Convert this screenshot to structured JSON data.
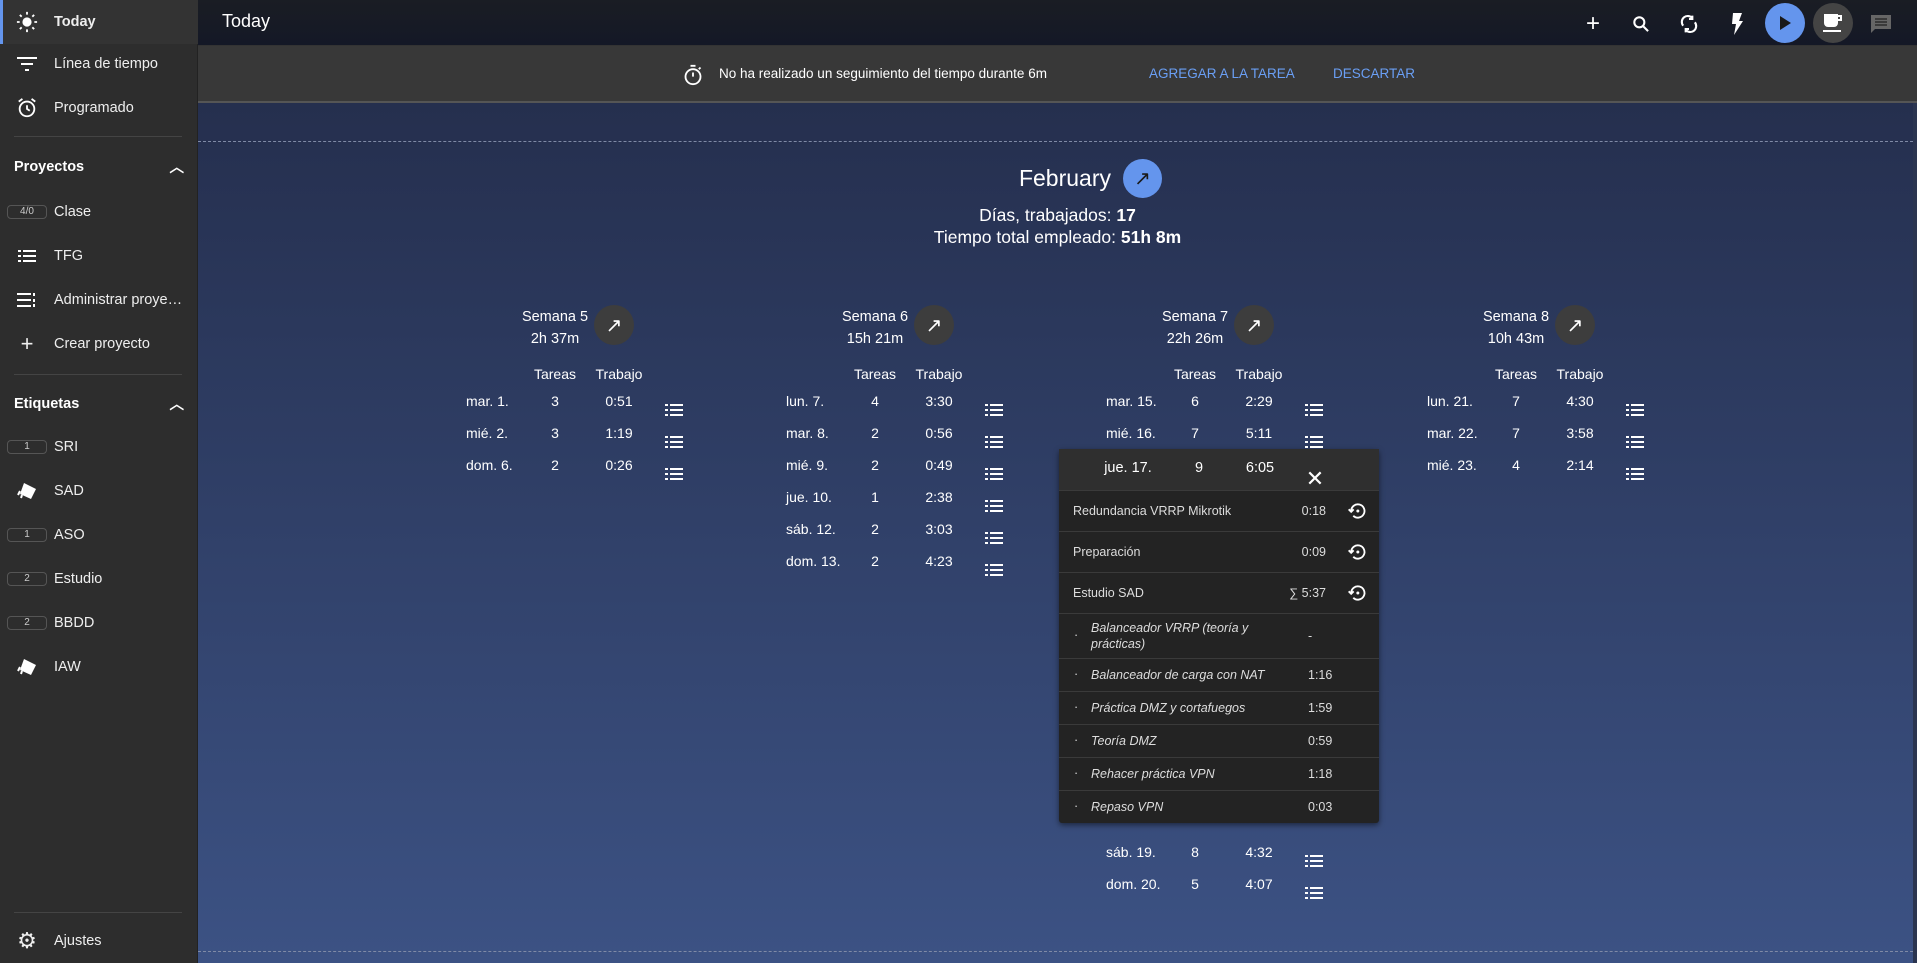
{
  "sidebar": {
    "nav": [
      {
        "label": "Today",
        "icon": "sun-icon"
      },
      {
        "label": "Línea de tiempo",
        "icon": "filter-icon"
      },
      {
        "label": "Programado",
        "icon": "alarm-icon"
      }
    ],
    "projects_header": "Proyectos",
    "projects": [
      {
        "label": "Clase",
        "badge": "4/0"
      },
      {
        "label": "TFG"
      },
      {
        "label": "Administrar proye…"
      },
      {
        "label": "Crear proyecto"
      }
    ],
    "tags_header": "Etiquetas",
    "tags": [
      {
        "label": "SRI",
        "badge": "1"
      },
      {
        "label": "SAD"
      },
      {
        "label": "ASO",
        "badge": "1"
      },
      {
        "label": "Estudio",
        "badge": "2"
      },
      {
        "label": "BBDD",
        "badge": "2"
      },
      {
        "label": "IAW"
      }
    ],
    "settings": "Ajustes"
  },
  "topbar": {
    "title": "Today"
  },
  "banner": {
    "text": "No ha realizado un seguimiento del tiempo durante 6m",
    "add": "AGREGAR A LA TAREA",
    "dismiss": "DESCARTAR"
  },
  "colors": {
    "accent": "#6495ed",
    "link": "#6a9ff5"
  },
  "month": {
    "title": "February",
    "days_label": "Días, trabajados:",
    "days": "17",
    "total_label": "Tiempo total empleado:",
    "total": "51h 8m"
  },
  "table_headers": {
    "tasks": "Tareas",
    "work": "Trabajo"
  },
  "weeks": [
    {
      "title": "Semana 5",
      "total": "2h 37m",
      "days": [
        {
          "day": "mar. 1.",
          "tasks": "3",
          "work": "0:51"
        },
        {
          "day": "mié. 2.",
          "tasks": "3",
          "work": "1:19"
        },
        {
          "day": "dom. 6.",
          "tasks": "2",
          "work": "0:26"
        }
      ]
    },
    {
      "title": "Semana 6",
      "total": "15h 21m",
      "days": [
        {
          "day": "lun. 7.",
          "tasks": "4",
          "work": "3:30"
        },
        {
          "day": "mar. 8.",
          "tasks": "2",
          "work": "0:56"
        },
        {
          "day": "mié. 9.",
          "tasks": "2",
          "work": "0:49"
        },
        {
          "day": "jue. 10.",
          "tasks": "1",
          "work": "2:38"
        },
        {
          "day": "sáb. 12.",
          "tasks": "2",
          "work": "3:03"
        },
        {
          "day": "dom. 13.",
          "tasks": "2",
          "work": "4:23"
        }
      ]
    },
    {
      "title": "Semana 7",
      "total": "22h 26m",
      "days": [
        {
          "day": "mar. 15.",
          "tasks": "6",
          "work": "2:29"
        },
        {
          "day": "mié. 16.",
          "tasks": "7",
          "work": "5:11"
        },
        {
          "day": "sáb. 19.",
          "tasks": "8",
          "work": "4:32"
        },
        {
          "day": "dom. 20.",
          "tasks": "5",
          "work": "4:07"
        }
      ]
    },
    {
      "title": "Semana 8",
      "total": "10h 43m",
      "days": [
        {
          "day": "lun. 21.",
          "tasks": "7",
          "work": "4:30"
        },
        {
          "day": "mar. 22.",
          "tasks": "7",
          "work": "3:58"
        },
        {
          "day": "mié. 23.",
          "tasks": "4",
          "work": "2:14"
        }
      ]
    }
  ],
  "popup": {
    "day": "jue. 17.",
    "tasks": "9",
    "work": "6:05",
    "tasks_list": [
      {
        "title": "Redundancia VRRP Mikrotik",
        "time": "0:18"
      },
      {
        "title": "Preparación",
        "time": "0:09"
      },
      {
        "title": "Estudio SAD",
        "time": "∑ 5:37"
      }
    ],
    "subtasks": [
      {
        "title": "Balanceador VRRP (teoría y prácticas)",
        "time": "-"
      },
      {
        "title": "Balanceador de carga con NAT",
        "time": "1:16"
      },
      {
        "title": "Práctica DMZ y cortafuegos",
        "time": "1:59"
      },
      {
        "title": "Teoría DMZ",
        "time": "0:59"
      },
      {
        "title": "Rehacer práctica VPN",
        "time": "1:18"
      },
      {
        "title": "Repaso VPN",
        "time": "0:03"
      }
    ]
  }
}
